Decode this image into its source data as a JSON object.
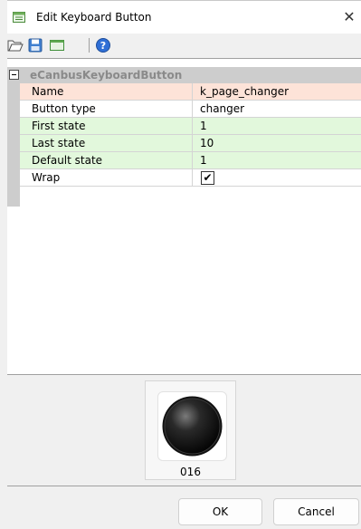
{
  "window": {
    "title": "Edit Keyboard Button",
    "close_glyph": "✕"
  },
  "toolbar": {
    "icons": [
      "open-folder-icon",
      "save-icon",
      "window-icon",
      "help-icon"
    ]
  },
  "property_grid": {
    "category": "eCanbusKeyboardButton",
    "rows": [
      {
        "name": "Name",
        "value": "k_page_changer"
      },
      {
        "name": "Button type",
        "value": "changer"
      },
      {
        "name": "First state",
        "value": "1"
      },
      {
        "name": "Last state",
        "value": "10"
      },
      {
        "name": "Default state",
        "value": "1"
      },
      {
        "name": "Wrap",
        "checked": true,
        "check_glyph": "✔"
      }
    ]
  },
  "preview": {
    "label": "016"
  },
  "footer": {
    "ok_label": "OK",
    "cancel_label": "Cancel"
  },
  "colors": {
    "name_row": "#fde3d8",
    "state_rows": "#e2f8dc",
    "category_bar": "#cdcdcd",
    "help_icon": "#2f6fd6"
  }
}
